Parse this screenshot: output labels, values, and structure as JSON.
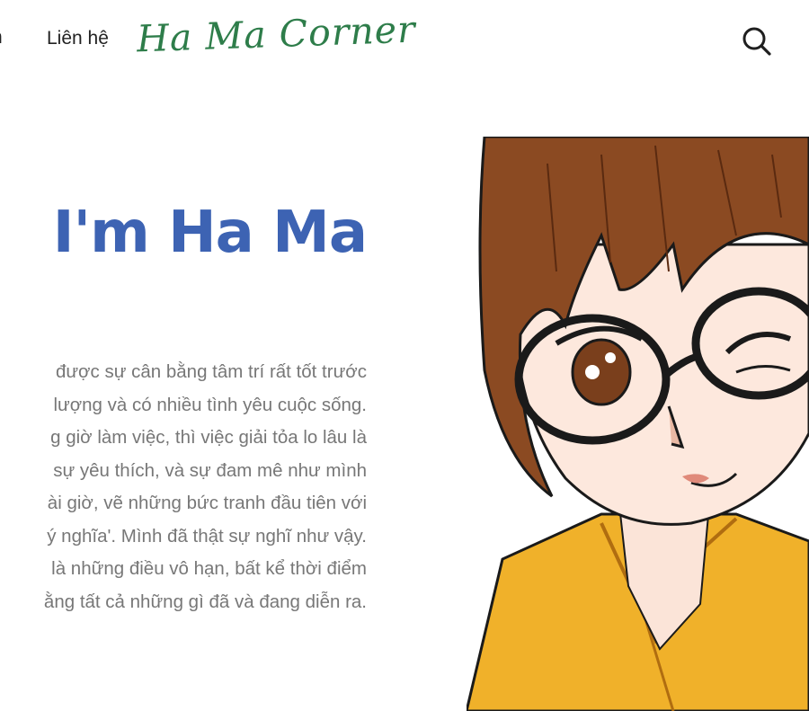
{
  "nav": {
    "cut_item": "n",
    "contact": "Liên hệ"
  },
  "logo": {
    "text": "Ha Ma Corner"
  },
  "search": {
    "icon": "search-icon"
  },
  "hero": {
    "title": "I'm Ha Ma",
    "lines": [
      "được sự cân bằng tâm trí rất tốt trước",
      "lượng và có nhiều tình yêu cuộc sống.",
      "g giờ làm việc, thì việc giải tỏa lo lâu là",
      "sự yêu thích, và sự đam mê như mình",
      "ài giờ, vẽ những bức tranh đầu tiên với",
      "ý nghĩa'. Mình đã thật sự nghĩ như vậy.",
      "là những điều vô hạn, bất kể thời điểm",
      "ằng tất cả những gì đã và đang diễn ra."
    ]
  },
  "colors": {
    "title": "#3d63b3",
    "logo": "#2e7d4a",
    "body_text": "#777777",
    "hair": "#8b4a22",
    "hoodie": "#f0b12a"
  }
}
